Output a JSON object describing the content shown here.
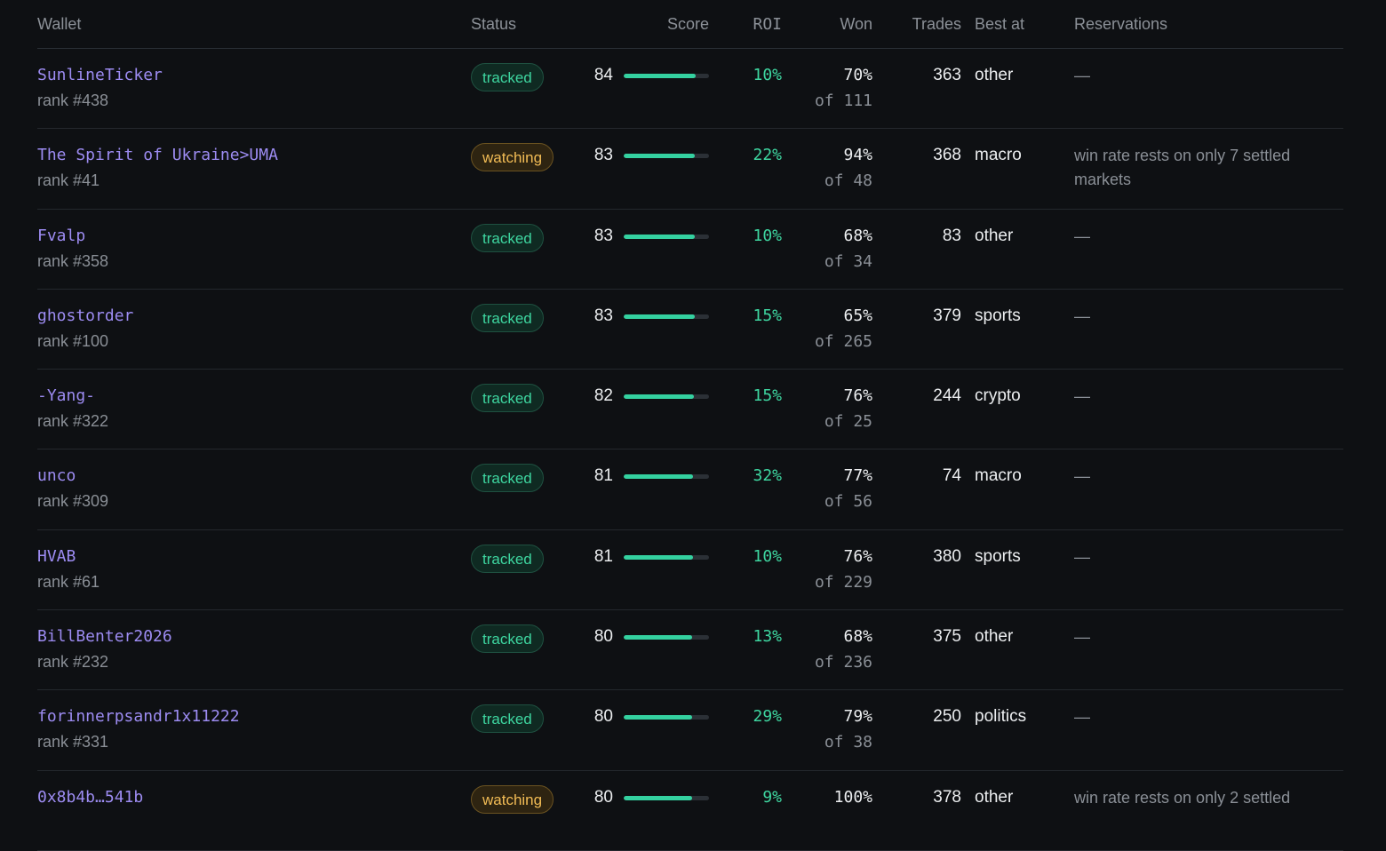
{
  "columns": {
    "wallet": "Wallet",
    "status": "Status",
    "score": "Score",
    "roi": "ROI",
    "won": "Won",
    "trades": "Trades",
    "best_at": "Best at",
    "reservations": "Reservations"
  },
  "colors": {
    "background": "#0e1013",
    "wallet_link": "#9d8cf2",
    "positive": "#3ed6a0",
    "tracked_badge": "#3ed6a0",
    "watching_badge": "#f2bc55"
  },
  "rows": [
    {
      "wallet": "SunlineTicker",
      "rank": "rank #438",
      "status": "tracked",
      "score": "84",
      "score_fraction": 0.84,
      "roi": "10%",
      "won": "70%",
      "won_of": "of 111",
      "trades": "363",
      "best_at": "other",
      "reservations": "—"
    },
    {
      "wallet": "The Spirit of Ukraine>UMA",
      "rank": "rank #41",
      "status": "watching",
      "score": "83",
      "score_fraction": 0.83,
      "roi": "22%",
      "won": "94%",
      "won_of": "of 48",
      "trades": "368",
      "best_at": "macro",
      "reservations": "win rate rests on only 7 settled markets"
    },
    {
      "wallet": "Fvalp",
      "rank": "rank #358",
      "status": "tracked",
      "score": "83",
      "score_fraction": 0.83,
      "roi": "10%",
      "won": "68%",
      "won_of": "of 34",
      "trades": "83",
      "best_at": "other",
      "reservations": "—"
    },
    {
      "wallet": "ghostorder",
      "rank": "rank #100",
      "status": "tracked",
      "score": "83",
      "score_fraction": 0.83,
      "roi": "15%",
      "won": "65%",
      "won_of": "of 265",
      "trades": "379",
      "best_at": "sports",
      "reservations": "—"
    },
    {
      "wallet": "-Yang-",
      "rank": "rank #322",
      "status": "tracked",
      "score": "82",
      "score_fraction": 0.82,
      "roi": "15%",
      "won": "76%",
      "won_of": "of 25",
      "trades": "244",
      "best_at": "crypto",
      "reservations": "—"
    },
    {
      "wallet": "unco",
      "rank": "rank #309",
      "status": "tracked",
      "score": "81",
      "score_fraction": 0.81,
      "roi": "32%",
      "won": "77%",
      "won_of": "of 56",
      "trades": "74",
      "best_at": "macro",
      "reservations": "—"
    },
    {
      "wallet": "HVAB",
      "rank": "rank #61",
      "status": "tracked",
      "score": "81",
      "score_fraction": 0.81,
      "roi": "10%",
      "won": "76%",
      "won_of": "of 229",
      "trades": "380",
      "best_at": "sports",
      "reservations": "—"
    },
    {
      "wallet": "BillBenter2026",
      "rank": "rank #232",
      "status": "tracked",
      "score": "80",
      "score_fraction": 0.8,
      "roi": "13%",
      "won": "68%",
      "won_of": "of 236",
      "trades": "375",
      "best_at": "other",
      "reservations": "—"
    },
    {
      "wallet": "forinnerpsandr1x11222",
      "rank": "rank #331",
      "status": "tracked",
      "score": "80",
      "score_fraction": 0.8,
      "roi": "29%",
      "won": "79%",
      "won_of": "of 38",
      "trades": "250",
      "best_at": "politics",
      "reservations": "—"
    },
    {
      "wallet": "0x8b4b…541b",
      "rank": "",
      "status": "watching",
      "score": "80",
      "score_fraction": 0.8,
      "roi": "9%",
      "won": "100%",
      "won_of": "",
      "trades": "378",
      "best_at": "other",
      "reservations": "win rate rests on only 2 settled"
    }
  ]
}
